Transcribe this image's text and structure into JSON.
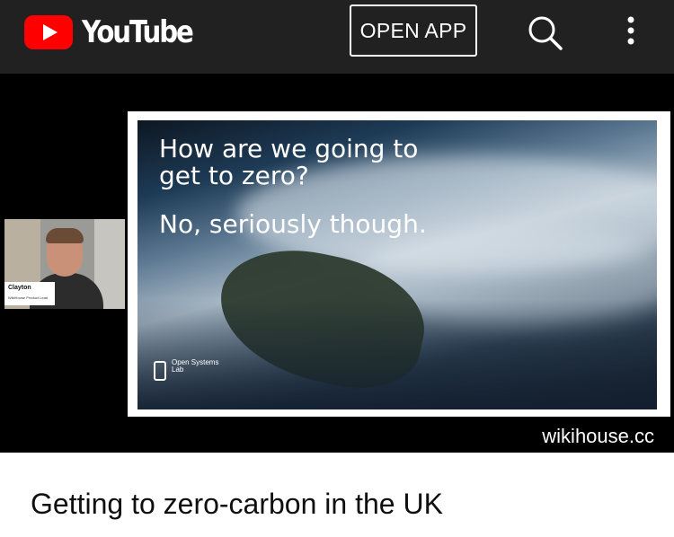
{
  "header": {
    "logo_text": "YouTube",
    "open_app_label": "OPEN APP",
    "search_icon": "search-icon",
    "more_icon": "more-vert-icon"
  },
  "video": {
    "webcam": {
      "name": "Clayton",
      "role": "WikiHouse Product Lead"
    },
    "slide": {
      "line1": "How are we going to",
      "line2": "get to zero?",
      "line3": "No, seriously though.",
      "logo_text": "Open Systems Lab"
    },
    "watermark": "wikihouse.cc"
  },
  "title": "Getting to zero-carbon in the UK",
  "colors": {
    "header_bg": "#212121",
    "brand_red": "#ff0000",
    "player_bg": "#000000"
  }
}
